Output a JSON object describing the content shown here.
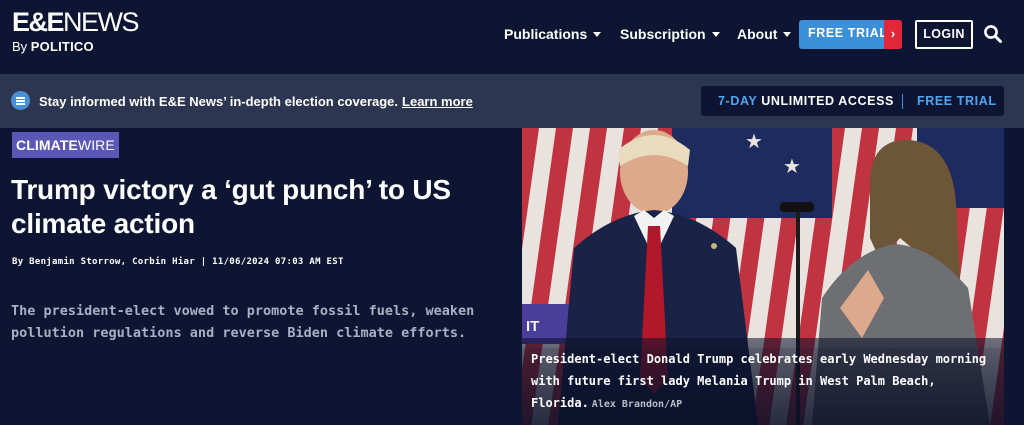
{
  "header": {
    "logo_main_1": "E&E",
    "logo_main_2": "NEWS",
    "logo_by": "By",
    "logo_politico": "POLITICO",
    "nav": [
      {
        "label": "Publications"
      },
      {
        "label": "Subscription"
      },
      {
        "label": "About"
      }
    ],
    "free_trial_label": "FREE TRIAL",
    "free_trial_arrow": "›",
    "login_label": "LOGIN",
    "icons": {
      "search": "search-icon",
      "caret": "chevron-down-icon",
      "chat": "chat-bubble-icon"
    }
  },
  "banner": {
    "text": "Stay informed with E&E News’ in-depth election coverage.",
    "link": "Learn more",
    "access_prefix": "7-DAY",
    "access_rest": " UNLIMITED ACCESS",
    "access_trial": "FREE TRIAL"
  },
  "article": {
    "tag_bold": "CLIMATE",
    "tag_light": "WIRE",
    "headline": "Trump victory a ‘gut punch’ to US climate action",
    "byline": "By Benjamin Storrow, Corbin Hiar | 11/06/2024 07:03 AM EST",
    "dek": "The president-elect vowed to promote fossil fuels, weaken pollution regulations and reverse Biden climate efforts."
  },
  "photo": {
    "caption": "President-elect Donald Trump celebrates early Wednesday morning with future first lady Melania Trump in West Palm Beach, Florida.",
    "credit": "Alex Brandon/AP",
    "sign_text": "IT"
  },
  "colors": {
    "background": "#0d1533",
    "banner": "#2d3650",
    "accent_blue": "#3c8fd9",
    "accent_red": "#e3273a",
    "tag_purple": "#5b57b5"
  }
}
